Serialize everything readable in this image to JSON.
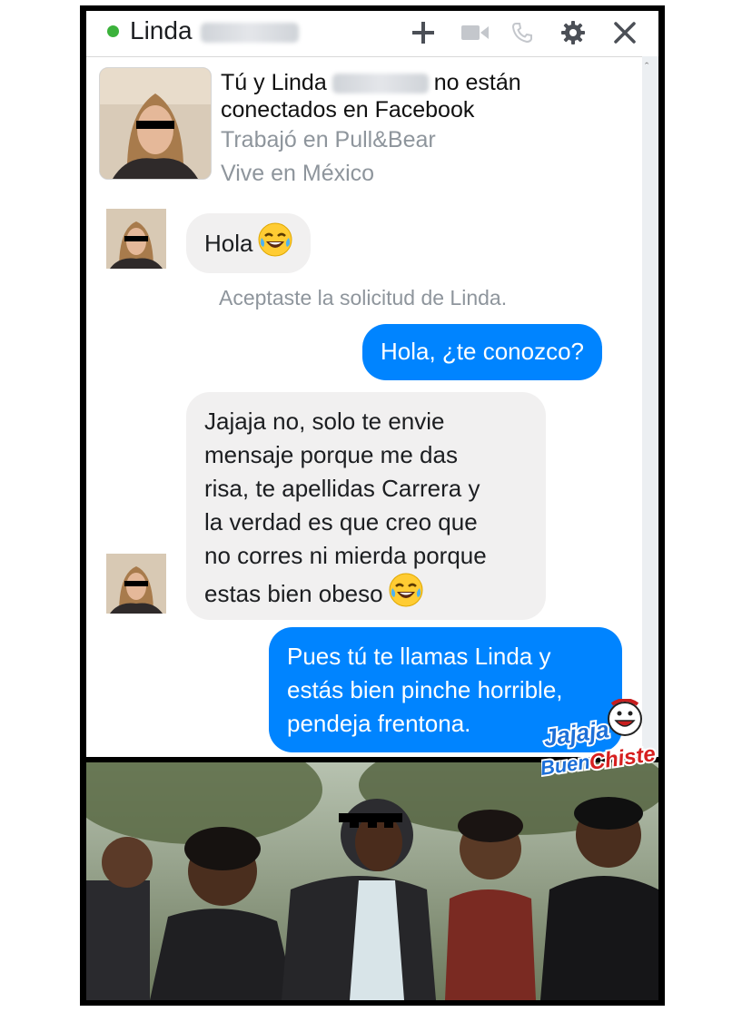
{
  "header": {
    "contact_first_name": "Linda",
    "status_color": "#3bb23b",
    "icons": [
      "plus-icon",
      "video-camera-icon",
      "phone-icon",
      "gear-icon",
      "close-icon"
    ]
  },
  "intro": {
    "line1_before": "Tú y Linda",
    "line1_after": "no están",
    "line2": "conectados en Facebook",
    "work": "Trabajó en Pull&Bear",
    "lives": "Vive en México"
  },
  "messages": [
    {
      "from": "them",
      "text": "Hola",
      "emoji": "laughing-tears-emoji"
    },
    {
      "from": "me",
      "text": "Hola, ¿te conozco?"
    },
    {
      "from": "them",
      "lines": [
        "Jajaja no, solo te envie",
        "mensaje porque me das",
        "risa, te apellidas Carrera y",
        "la verdad es que creo que",
        "no corres ni mierda porque",
        "estas bien obeso"
      ],
      "emoji": "laughing-tears-emoji"
    },
    {
      "from": "me",
      "lines": [
        "Pues tú te llamas Linda y",
        "estás bien pinche horrible,",
        "pendeja frentona."
      ]
    }
  ],
  "system_notice": "Aceptaste la solicitud de Linda.",
  "watermark": {
    "line1": "Jajaja",
    "line2_a": "Buen",
    "line2_b": "Chiste"
  },
  "colors": {
    "outgoing": "#0084ff",
    "incoming": "#f1f0f0",
    "muted": "#8e959c"
  }
}
